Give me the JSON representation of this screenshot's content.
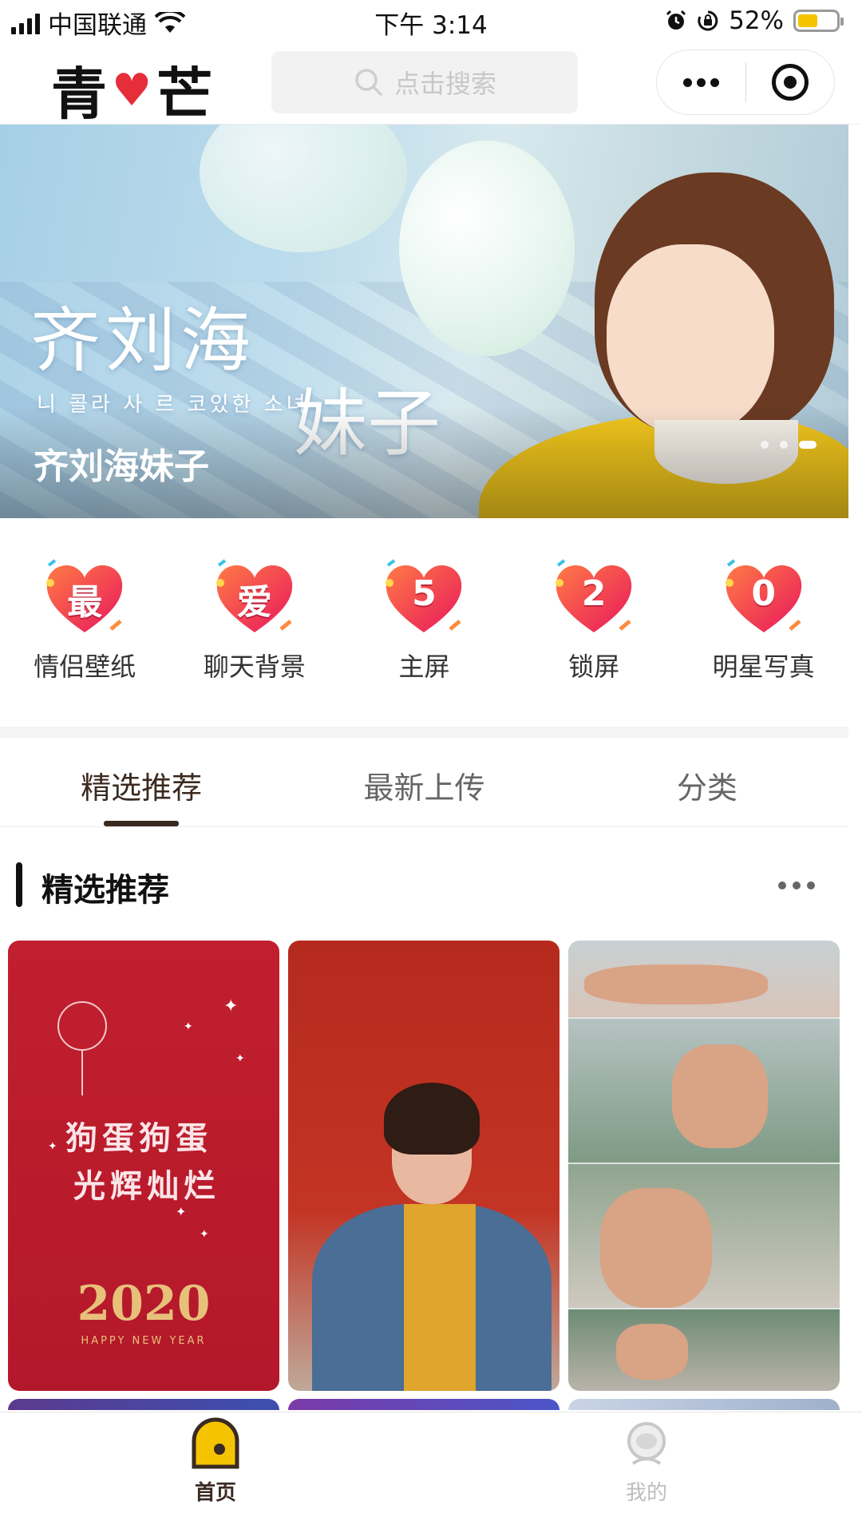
{
  "status_bar": {
    "carrier": "中国联通",
    "time": "下午 3:14",
    "battery": "52%"
  },
  "header": {
    "logo_left": "青",
    "logo_right": "芒",
    "search_placeholder": "点击搜索"
  },
  "banner": {
    "title": "齐刘海妹子",
    "art_line1": "齐刘海",
    "art_line2": "妹子",
    "art_korean": "니 콜라 사 르 코있한 소녀",
    "slide_count": 3,
    "active_slide": 3
  },
  "categories": [
    {
      "icon_char": "最",
      "label": "情侣壁纸"
    },
    {
      "icon_char": "爱",
      "label": "聊天背景"
    },
    {
      "icon_char": "5",
      "label": "主屏"
    },
    {
      "icon_char": "2",
      "label": "锁屏"
    },
    {
      "icon_char": "0",
      "label": "明星写真"
    }
  ],
  "tabs": [
    {
      "label": "精选推荐",
      "active": true
    },
    {
      "label": "最新上传",
      "active": false
    },
    {
      "label": "分类",
      "active": false
    }
  ],
  "section": {
    "title": "精选推荐"
  },
  "cards": [
    {
      "line1": "狗蛋狗蛋",
      "line2": "光辉灿烂",
      "year": "2020",
      "subtitle": "HAPPY NEW YEAR"
    },
    {},
    {}
  ],
  "bottom_nav": [
    {
      "label": "首页",
      "icon": "home-icon",
      "active": true
    },
    {
      "label": "我的",
      "icon": "profile-icon",
      "active": false
    }
  ],
  "colors": {
    "accent": "#3a2a22",
    "heart": "#e62d3a",
    "battery": "#f5c400"
  }
}
